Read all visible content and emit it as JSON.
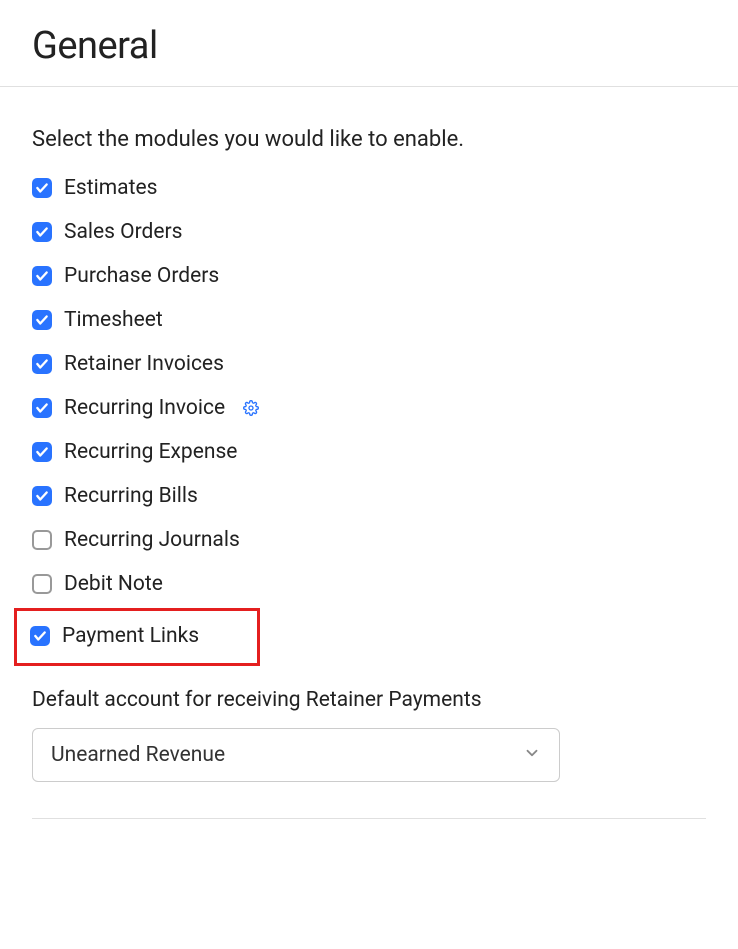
{
  "header": {
    "title": "General"
  },
  "modules": {
    "heading": "Select the modules you would like to enable.",
    "items": [
      {
        "label": "Estimates",
        "checked": true,
        "gear": false,
        "highlighted": false
      },
      {
        "label": "Sales Orders",
        "checked": true,
        "gear": false,
        "highlighted": false
      },
      {
        "label": "Purchase Orders",
        "checked": true,
        "gear": false,
        "highlighted": false
      },
      {
        "label": "Timesheet",
        "checked": true,
        "gear": false,
        "highlighted": false
      },
      {
        "label": "Retainer Invoices",
        "checked": true,
        "gear": false,
        "highlighted": false
      },
      {
        "label": "Recurring Invoice",
        "checked": true,
        "gear": true,
        "highlighted": false
      },
      {
        "label": "Recurring Expense",
        "checked": true,
        "gear": false,
        "highlighted": false
      },
      {
        "label": "Recurring Bills",
        "checked": true,
        "gear": false,
        "highlighted": false
      },
      {
        "label": "Recurring Journals",
        "checked": false,
        "gear": false,
        "highlighted": false
      },
      {
        "label": "Debit Note",
        "checked": false,
        "gear": false,
        "highlighted": false
      },
      {
        "label": "Payment Links",
        "checked": true,
        "gear": false,
        "highlighted": true
      }
    ]
  },
  "default_account": {
    "label": "Default account for receiving Retainer Payments",
    "value": "Unearned Revenue"
  }
}
